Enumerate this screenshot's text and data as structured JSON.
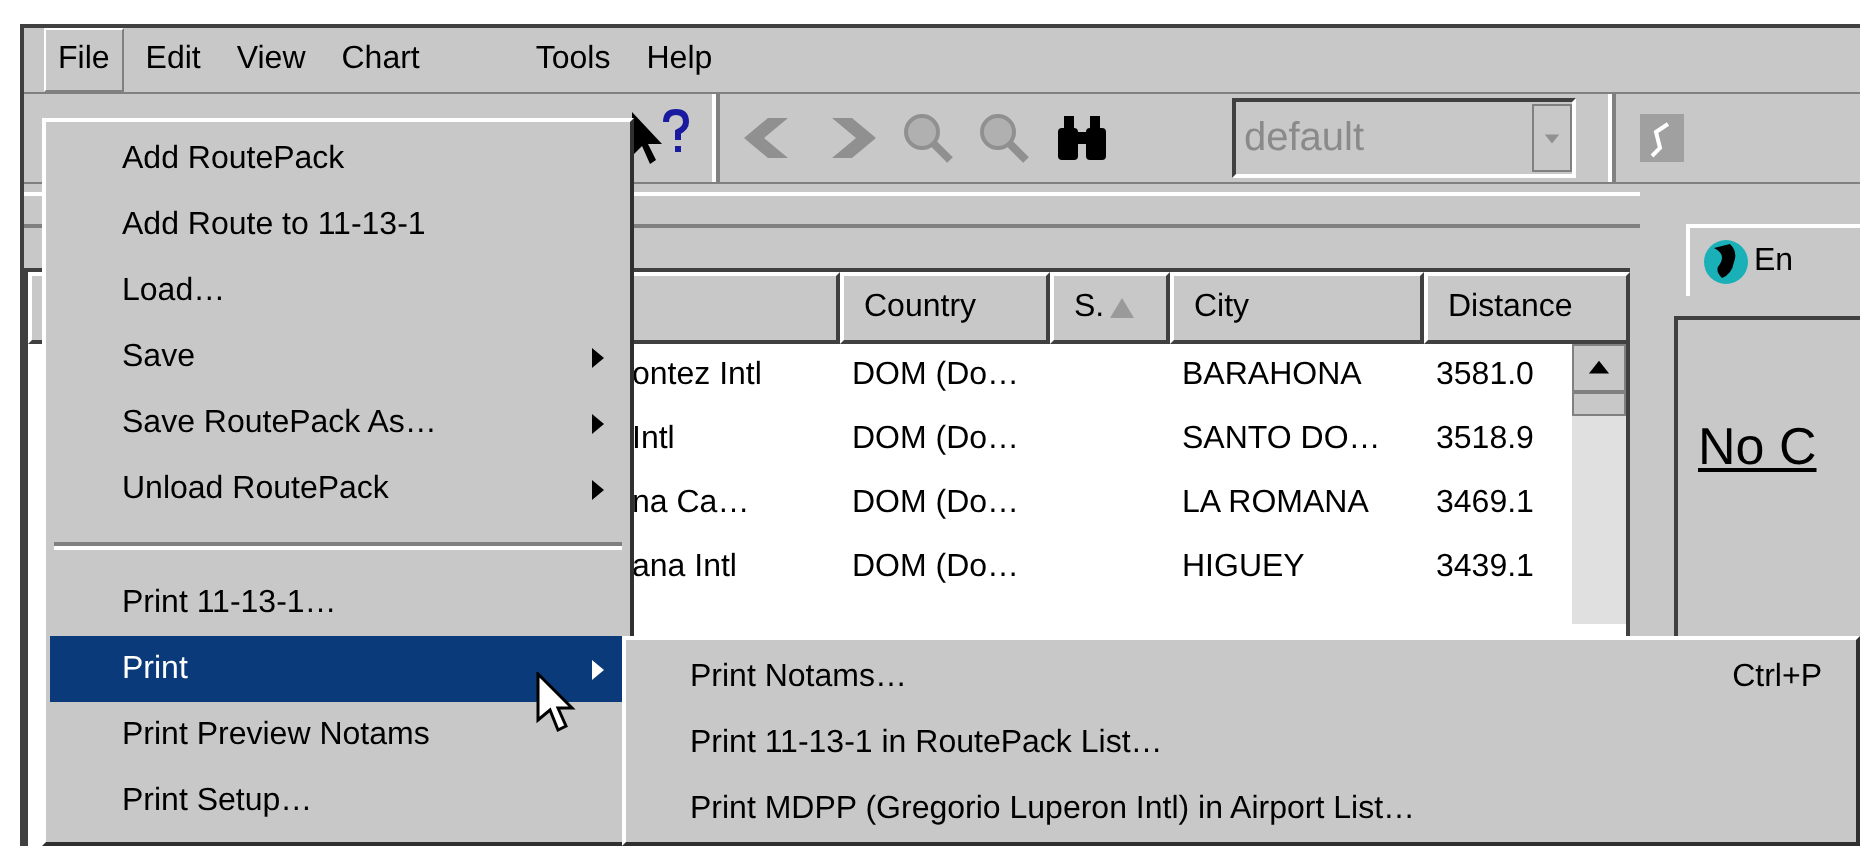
{
  "menubar": [
    {
      "label": "File",
      "selected": true
    },
    {
      "label": "Edit",
      "selected": false
    },
    {
      "label": "View",
      "selected": false
    },
    {
      "label": "Chart",
      "selected": false
    },
    {
      "label": "Tools",
      "selected": false
    },
    {
      "label": "Help",
      "selected": false
    }
  ],
  "toolbar": {
    "style_combo": {
      "value": "default",
      "disabled": true
    }
  },
  "table": {
    "columns": [
      {
        "label": "Country",
        "sorted": false
      },
      {
        "label": "S.",
        "sorted": true
      },
      {
        "label": "City",
        "sorted": false
      },
      {
        "label": "Distance",
        "sorted": false
      }
    ],
    "rows": [
      {
        "column_1": "ontez Intl",
        "country": "DOM (Do…",
        "s": "",
        "city": "BARAHONA",
        "distance": "3581.0"
      },
      {
        "column_1": "Intl",
        "country": "DOM (Do…",
        "s": "",
        "city": "SANTO DO…",
        "distance": "3518.9"
      },
      {
        "column_1": "na Ca…",
        "country": "DOM (Do…",
        "s": "",
        "city": "LA ROMANA",
        "distance": "3469.1"
      },
      {
        "column_1": "ana Intl",
        "country": "DOM (Do…",
        "s": "",
        "city": "HIGUEY",
        "distance": "3439.1"
      }
    ]
  },
  "side_panel": {
    "tab": "En",
    "heading": "No C"
  },
  "file_menu": [
    {
      "kind": "item",
      "label": "Add RoutePack",
      "submenu": false,
      "selected": false
    },
    {
      "kind": "item",
      "label": "Add Route to 11-13-1",
      "submenu": false,
      "selected": false
    },
    {
      "kind": "item",
      "label": "Load…",
      "submenu": false,
      "selected": false
    },
    {
      "kind": "item",
      "label": "Save",
      "submenu": true,
      "selected": false
    },
    {
      "kind": "item",
      "label": "Save RoutePack As…",
      "submenu": true,
      "selected": false
    },
    {
      "kind": "item",
      "label": "Unload RoutePack",
      "submenu": true,
      "selected": false
    },
    {
      "kind": "separator"
    },
    {
      "kind": "item",
      "label": "Print 11-13-1…",
      "submenu": false,
      "selected": false
    },
    {
      "kind": "item",
      "label": "Print",
      "submenu": true,
      "selected": true
    },
    {
      "kind": "item",
      "label": "Print Preview Notams",
      "submenu": false,
      "selected": false
    },
    {
      "kind": "item",
      "label": "Print Setup…",
      "submenu": false,
      "selected": false
    }
  ],
  "print_submenu": [
    {
      "label": "Print Notams…",
      "shortcut": "Ctrl+P"
    },
    {
      "label": "Print 11-13-1 in RoutePack List…"
    },
    {
      "label": "Print MDPP (Gregorio Luperon Intl) in Airport List…"
    }
  ]
}
